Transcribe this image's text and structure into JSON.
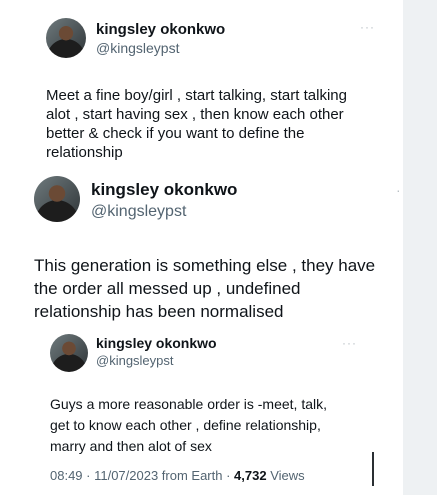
{
  "tweets": [
    {
      "name": "kingsley okonkwo",
      "handle": "@kingsleypst",
      "more": "···",
      "text": "Meet a fine boy/girl , start talking,  start talking\nalot , start having sex , then know each other\nbetter & check if you want to define the\nrelationship"
    },
    {
      "name": "kingsley okonkwo",
      "handle": "@kingsleypst",
      "more": "·",
      "text": "This generation is something else , they have\nthe order all messed up , undefined\nrelationship has been normalised"
    },
    {
      "name": "kingsley okonkwo",
      "handle": "@kingsleypst",
      "more": "···",
      "text": "Guys a more reasonable order is -meet, talk,\nget to know each other , define relationship,\nmarry and then alot of sex",
      "footer": {
        "time": "08:49 · 11/07/2023 from Earth ·",
        "views_count": "4,732",
        "views_label": "Views"
      }
    }
  ]
}
